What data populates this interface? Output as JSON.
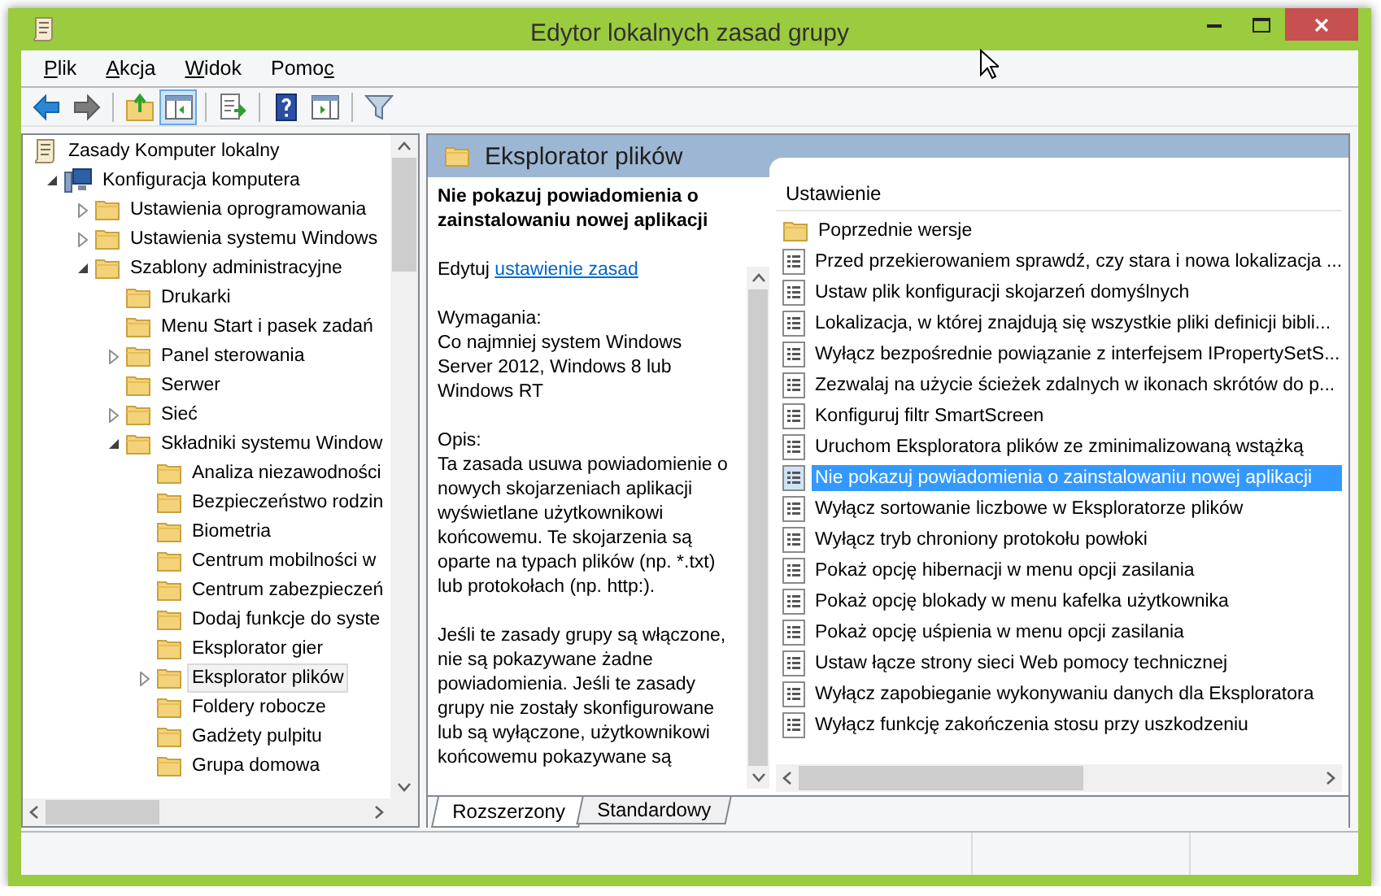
{
  "window": {
    "title": "Edytor lokalnych zasad grupy"
  },
  "menu": [
    {
      "key": "P",
      "post": "lik"
    },
    {
      "key": "A",
      "post": "kcja"
    },
    {
      "key": "W",
      "post": "idok"
    },
    {
      "pre": "Pomo",
      "key": "c"
    }
  ],
  "toolbar_groups": [
    [
      {
        "kind": "back",
        "pressed": false
      },
      {
        "kind": "forward",
        "pressed": false
      }
    ],
    [
      {
        "kind": "up",
        "pressed": false
      },
      {
        "kind": "tree",
        "pressed": true
      }
    ],
    [
      {
        "kind": "export",
        "pressed": false
      }
    ],
    [
      {
        "kind": "help",
        "pressed": false
      },
      {
        "kind": "actions",
        "pressed": false
      }
    ],
    [
      {
        "kind": "filter",
        "pressed": false
      }
    ]
  ],
  "tree": [
    {
      "label": "Zasady Komputer lokalny",
      "kind": "policy",
      "expandable": false,
      "selected": false,
      "children": [
        {
          "label": "Konfiguracja komputera",
          "kind": "computer",
          "expandable": true,
          "expanded": true,
          "selected": false,
          "children": [
            {
              "label": "Ustawienia oprogramowania",
              "kind": "folder",
              "expandable": true,
              "expanded": false,
              "selected": false
            },
            {
              "label": "Ustawienia systemu Windows",
              "kind": "folder",
              "expandable": true,
              "expanded": false,
              "selected": false
            },
            {
              "label": "Szablony administracyjne",
              "kind": "folder",
              "expandable": true,
              "expanded": true,
              "selected": false,
              "children": [
                {
                  "label": "Drukarki",
                  "kind": "folder",
                  "expandable": false,
                  "selected": false
                },
                {
                  "label": "Menu Start i pasek zadań",
                  "kind": "folder",
                  "expandable": false,
                  "selected": false
                },
                {
                  "label": "Panel sterowania",
                  "kind": "folder",
                  "expandable": true,
                  "expanded": false,
                  "selected": false
                },
                {
                  "label": "Serwer",
                  "kind": "folder",
                  "expandable": false,
                  "selected": false
                },
                {
                  "label": "Sieć",
                  "kind": "folder",
                  "expandable": true,
                  "expanded": false,
                  "selected": false
                },
                {
                  "label": "Składniki systemu Window",
                  "kind": "folder",
                  "expandable": true,
                  "expanded": true,
                  "selected": false,
                  "children": [
                    {
                      "label": "Analiza niezawodności",
                      "kind": "folder",
                      "expandable": false,
                      "selected": false
                    },
                    {
                      "label": "Bezpieczeństwo rodzin",
                      "kind": "folder",
                      "expandable": false,
                      "selected": false
                    },
                    {
                      "label": "Biometria",
                      "kind": "folder",
                      "expandable": false,
                      "selected": false
                    },
                    {
                      "label": "Centrum mobilności w",
                      "kind": "folder",
                      "expandable": false,
                      "selected": false
                    },
                    {
                      "label": "Centrum zabezpieczeń",
                      "kind": "folder",
                      "expandable": false,
                      "selected": false
                    },
                    {
                      "label": "Dodaj funkcje do syste",
                      "kind": "folder",
                      "expandable": false,
                      "selected": false
                    },
                    {
                      "label": "Eksplorator gier",
                      "kind": "folder",
                      "expandable": false,
                      "selected": false
                    },
                    {
                      "label": "Eksplorator plików",
                      "kind": "folder",
                      "expandable": true,
                      "expanded": false,
                      "selected": true
                    },
                    {
                      "label": "Foldery robocze",
                      "kind": "folder",
                      "expandable": false,
                      "selected": false
                    },
                    {
                      "label": "Gadżety pulpitu",
                      "kind": "folder",
                      "expandable": false,
                      "selected": false
                    },
                    {
                      "label": "Grupa domowa",
                      "kind": "folder",
                      "expandable": false,
                      "selected": false
                    }
                  ]
                }
              ]
            }
          ]
        }
      ]
    }
  ],
  "panel": {
    "title": "Eksplorator plików"
  },
  "description": {
    "title": "Nie pokazuj powiadomienia o zainstalowaniu nowej aplikacji",
    "edit_prefix": "Edytuj",
    "edit_link": "ustawienie zasad",
    "sections": [
      {
        "heading": "Wymagania:",
        "text": "Co najmniej system Windows Server 2012, Windows 8 lub Windows RT"
      },
      {
        "heading": "Opis:",
        "text": "Ta zasada usuwa powiadomienie o nowych skojarzeniach aplikacji wyświetlane użytkownikowi końcowemu. Te skojarzenia są oparte na typach plików (np. *.txt) lub protokołach (np. http:)."
      },
      {
        "text": "Jeśli te zasady grupy są włączone, nie są pokazywane żadne powiadomienia. Jeśli te zasady grupy nie zostały skonfigurowane lub są wyłączone, użytkownikowi końcowemu pokazywane są"
      }
    ]
  },
  "list": {
    "column": "Ustawienie",
    "rows": [
      {
        "kind": "folder",
        "label": "Poprzednie wersje",
        "selected": false
      },
      {
        "kind": "setting",
        "label": "Przed przekierowaniem sprawdź, czy stara i nowa lokalizacja ...",
        "selected": false
      },
      {
        "kind": "setting",
        "label": "Ustaw plik konfiguracji skojarzeń domyślnych",
        "selected": false
      },
      {
        "kind": "setting",
        "label": "Lokalizacja, w której znajdują się wszystkie pliki definicji bibli...",
        "selected": false
      },
      {
        "kind": "setting",
        "label": "Wyłącz bezpośrednie powiązanie z interfejsem IPropertySetS...",
        "selected": false
      },
      {
        "kind": "setting",
        "label": "Zezwalaj na użycie ścieżek zdalnych w ikonach skrótów do p...",
        "selected": false
      },
      {
        "kind": "setting",
        "label": "Konfiguruj filtr SmartScreen",
        "selected": false
      },
      {
        "kind": "setting",
        "label": "Uruchom Eksploratora plików ze zminimalizowaną wstążką",
        "selected": false
      },
      {
        "kind": "setting",
        "label": "Nie pokazuj powiadomienia o zainstalowaniu nowej aplikacji",
        "selected": true
      },
      {
        "kind": "setting",
        "label": "Wyłącz sortowanie liczbowe w Eksploratorze plików",
        "selected": false
      },
      {
        "kind": "setting",
        "label": "Wyłącz tryb chroniony protokołu powłoki",
        "selected": false
      },
      {
        "kind": "setting",
        "label": "Pokaż opcję hibernacji w menu opcji zasilania",
        "selected": false
      },
      {
        "kind": "setting",
        "label": "Pokaż opcję blokady w menu kafelka użytkownika",
        "selected": false
      },
      {
        "kind": "setting",
        "label": "Pokaż opcję uśpienia w menu opcji zasilania",
        "selected": false
      },
      {
        "kind": "setting",
        "label": "Ustaw łącze strony sieci Web pomocy technicznej",
        "selected": false
      },
      {
        "kind": "setting",
        "label": "Wyłącz zapobieganie wykonywaniu danych dla Eksploratora",
        "selected": false
      },
      {
        "kind": "setting",
        "label": "Wyłącz funkcję zakończenia stosu przy uszkodzeniu",
        "selected": false
      }
    ]
  },
  "tabs": [
    {
      "label": "Rozszerzony",
      "selected": true
    },
    {
      "label": "Standardowy",
      "selected": false
    }
  ]
}
